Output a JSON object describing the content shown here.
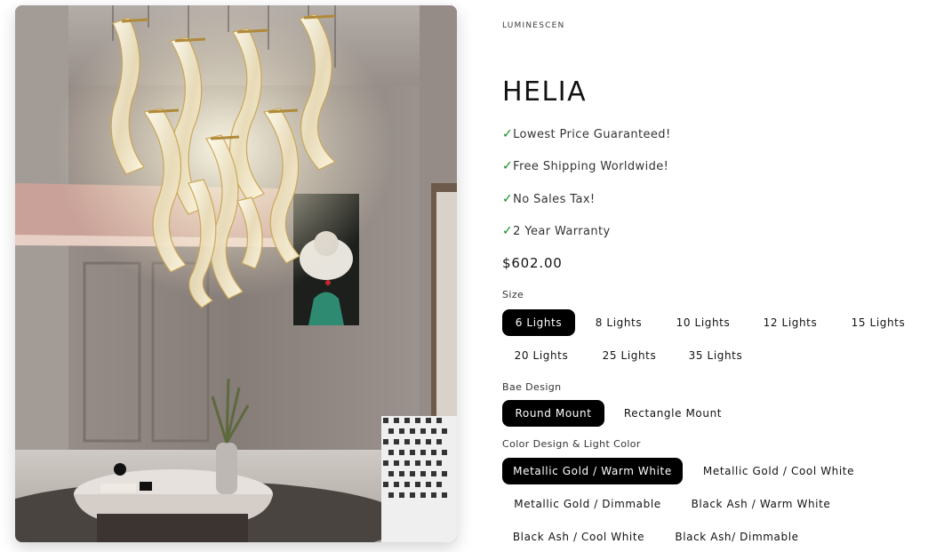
{
  "product": {
    "vendor": "LUMINESCEN",
    "title": "HELIA",
    "perks": [
      {
        "check": "✓",
        "text": "Lowest Price Guaranteed!"
      },
      {
        "check": "✓",
        "text": "Free Shipping Worldwide!"
      },
      {
        "check": "✓",
        "text": "No Sales Tax!"
      },
      {
        "check": "✓",
        "text": "2 Year Warranty"
      }
    ],
    "price": "$602.00"
  },
  "options": {
    "size": {
      "label": "Size",
      "values": [
        "6 Lights",
        "8 Lights",
        "10 Lights",
        "12 Lights",
        "15 Lights",
        "20 Lights",
        "25 Lights",
        "35 Lights"
      ],
      "selected": "6 Lights"
    },
    "base": {
      "label": "Bae Design",
      "values": [
        "Round Mount",
        "Rectangle Mount"
      ],
      "selected": "Round Mount"
    },
    "color": {
      "label": "Color Design & Light Color",
      "values": [
        "Metallic Gold / Warm White",
        "Metallic Gold / Cool White",
        "Metallic Gold / Dimmable",
        "Black Ash / Warm White",
        "Black Ash / Cool White",
        "Black Ash/ Dimmable"
      ],
      "selected": "Metallic Gold / Warm White"
    }
  },
  "colors": {
    "selected_bg": "#000000",
    "check": "#0a8f1b",
    "text": "#121212"
  },
  "icons": {
    "perk": "checkmark-icon"
  }
}
